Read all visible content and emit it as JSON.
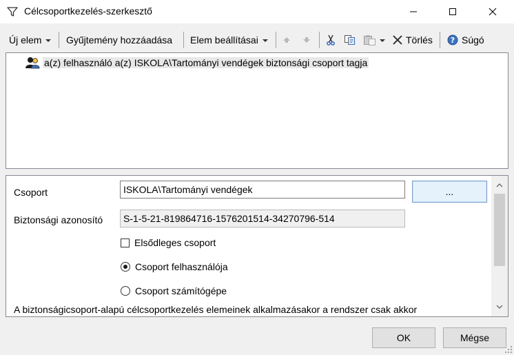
{
  "window": {
    "title": "Célcsoportkezelés-szerkesztő",
    "icon": "filter-icon"
  },
  "toolbar": {
    "new_item": "Új elem",
    "add_collection": "Gyűjtemény hozzáadása",
    "item_options": "Elem beállításai",
    "move_up_icon": "arrow-up-icon",
    "move_down_icon": "arrow-down-icon",
    "cut_icon": "scissors-icon",
    "copy_icon": "copy-icon",
    "paste_icon": "paste-icon",
    "delete": "Törlés",
    "help": "Súgó"
  },
  "list": {
    "items": [
      {
        "icon": "users-group-icon",
        "label": "a(z) felhasználó a(z) ISKOLA\\Tartományi vendégek biztonsági csoport tagja",
        "selected": true
      }
    ]
  },
  "properties": {
    "group_label": "Csoport",
    "group_value": "ISKOLA\\Tartományi vendégek",
    "browse_label": "...",
    "sid_label": "Biztonsági azonosító",
    "sid_value": "S-1-5-21-819864716-1576201514-34270796-514",
    "primary_group_label": "Elsődleges csoport",
    "primary_group_checked": false,
    "user_option_label": "Csoport felhasználója",
    "user_option_selected": true,
    "computer_option_label": "Csoport számítógépe",
    "computer_option_selected": false,
    "description": "A biztonságicsoport-alapú célcsoportkezelés elemeinek alkalmazásakor a rendszer csak akkor"
  },
  "buttons": {
    "ok": "OK",
    "cancel": "Mégse"
  },
  "colors": {
    "accent": "#0078d7",
    "help_icon": "#3a72c4",
    "disabled_arrow": "#b0b0b0",
    "browse_button_bg": "#e5f1fb"
  }
}
